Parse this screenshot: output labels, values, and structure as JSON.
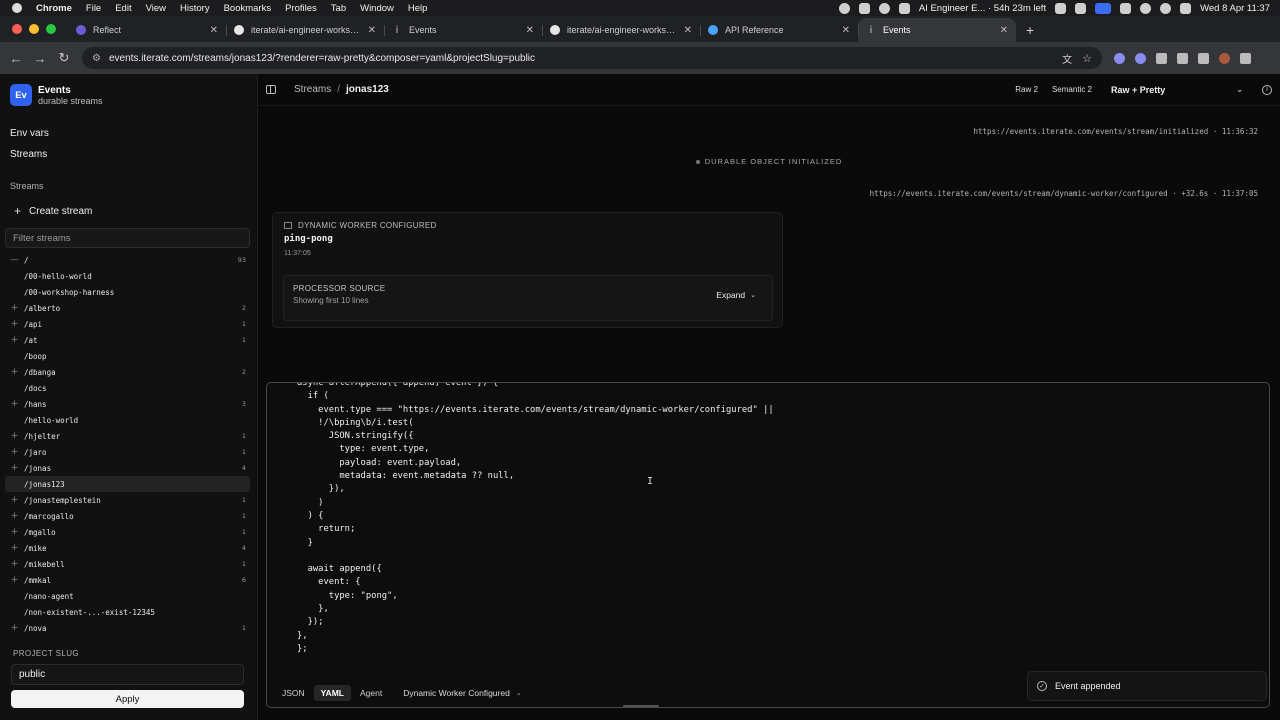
{
  "menubar": {
    "app": "Chrome",
    "items": [
      "File",
      "Edit",
      "View",
      "History",
      "Bookmarks",
      "Profiles",
      "Tab",
      "Window",
      "Help"
    ],
    "status_text": "AI Engineer E... · 54h 23m left",
    "clock": "Wed 8 Apr  11:37"
  },
  "tabs": [
    {
      "title": "Reflect",
      "favicon": "reflect-icon"
    },
    {
      "title": "iterate/ai-engineer-workshop",
      "favicon": "github-icon"
    },
    {
      "title": "Events",
      "favicon": "events-icon"
    },
    {
      "title": "iterate/ai-engineer-workshop",
      "favicon": "github-icon"
    },
    {
      "title": "API Reference",
      "favicon": "api-icon"
    },
    {
      "title": "Events",
      "favicon": "events-icon"
    }
  ],
  "address_bar": {
    "url": "events.iterate.com/streams/jonas123/?renderer=raw-pretty&composer=yaml&projectSlug=public"
  },
  "sidebar": {
    "logo_text": "Ev",
    "brand_name": "Events",
    "brand_sub": "durable streams",
    "links": [
      "Env vars",
      "Streams"
    ],
    "section_label": "Streams",
    "create_label": "Create stream",
    "filter_placeholder": "Filter streams",
    "tree": [
      {
        "toggle": "—",
        "label": "/",
        "count": "93"
      },
      {
        "toggle": "",
        "label": "/00-hello-world",
        "count": ""
      },
      {
        "toggle": "",
        "label": "/00-workshop-harness",
        "count": ""
      },
      {
        "toggle": "+",
        "label": "/alberto",
        "count": "2"
      },
      {
        "toggle": "+",
        "label": "/api",
        "count": "1"
      },
      {
        "toggle": "+",
        "label": "/at",
        "count": "1"
      },
      {
        "toggle": "",
        "label": "/boop",
        "count": ""
      },
      {
        "toggle": "+",
        "label": "/dbanga",
        "count": "2"
      },
      {
        "toggle": "",
        "label": "/docs",
        "count": ""
      },
      {
        "toggle": "+",
        "label": "/hans",
        "count": "3"
      },
      {
        "toggle": "",
        "label": "/hello-world",
        "count": ""
      },
      {
        "toggle": "+",
        "label": "/hjelter",
        "count": "1"
      },
      {
        "toggle": "+",
        "label": "/jaro",
        "count": "1"
      },
      {
        "toggle": "+",
        "label": "/jonas",
        "count": "4"
      },
      {
        "toggle": "",
        "label": "/jonas123",
        "count": "",
        "selected": true
      },
      {
        "toggle": "+",
        "label": "/jonastemplestein",
        "count": "1"
      },
      {
        "toggle": "+",
        "label": "/marcogallo",
        "count": "1"
      },
      {
        "toggle": "+",
        "label": "/mgallo",
        "count": "1"
      },
      {
        "toggle": "+",
        "label": "/mike",
        "count": "4"
      },
      {
        "toggle": "+",
        "label": "/mikebell",
        "count": "1"
      },
      {
        "toggle": "+",
        "label": "/mmkal",
        "count": "6"
      },
      {
        "toggle": "",
        "label": "/nano-agent",
        "count": ""
      },
      {
        "toggle": "",
        "label": "/non-existent-...-exist-12345",
        "count": ""
      },
      {
        "toggle": "+",
        "label": "/nova",
        "count": "1"
      }
    ],
    "project_slug_label": "PROJECT SLUG",
    "project_slug_value": "public",
    "apply_label": "Apply"
  },
  "topbar": {
    "crumb_root": "Streams",
    "crumb_sep": "/",
    "crumb_current": "jonas123",
    "raw_label": "Raw 2",
    "semantic_label": "Semantic 2",
    "renderer_value": "Raw + Pretty"
  },
  "events": {
    "initialized_meta": "https://events.iterate.com/events/stream/initialized · 11:36:32",
    "initialized_label": "DURABLE OBJECT INITIALIZED",
    "configured_meta": "https://events.iterate.com/events/stream/dynamic-worker/configured · +32.6s · 11:37:05",
    "card_head": "DYNAMIC WORKER CONFIGURED",
    "card_title": "ping-pong",
    "card_time": "11:37:05",
    "proc_title": "PROCESSOR SOURCE",
    "proc_sub": "Showing first 10 lines",
    "expand_label": "Expand"
  },
  "composer": {
    "code": "async afterAppend({ append, event }) {\n  if (\n    event.type === \"https://events.iterate.com/events/stream/dynamic-worker/configured\" ||\n    !/\\bping\\b/i.test(\n      JSON.stringify({\n        type: event.type,\n        payload: event.payload,\n        metadata: event.metadata ?? null,\n      }),\n    )\n  ) {\n    return;\n  }\n\n  await append({\n    event: {\n      type: \"pong\",\n    },\n  });\n},\n};",
    "tabs": [
      "JSON",
      "YAML",
      "Agent"
    ],
    "active_tab": "YAML",
    "event_type": "Dynamic Worker Configured"
  },
  "toast": {
    "message": "Event appended"
  }
}
